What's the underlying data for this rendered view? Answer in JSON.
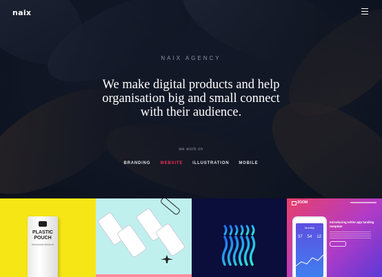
{
  "header": {
    "logo": "naix",
    "menu_icon": "hamburger-menu-icon"
  },
  "hero": {
    "kicker": "NAIX AGENCY",
    "headline_lines": [
      "We make digital products and help",
      "organisation big and small connect",
      "with their audience."
    ],
    "work_on_label": "we work on",
    "categories": [
      {
        "label": "BRANDING",
        "active": false
      },
      {
        "label": "WEBSITE",
        "active": true
      },
      {
        "label": "ILLUSTRATION",
        "active": false
      },
      {
        "label": "MOBILE",
        "active": false
      }
    ],
    "accent_color": "#ee2e5a"
  },
  "portfolio": {
    "tile1": {
      "bg": "#f6e615",
      "pouch_title": "PLASTIC POUCH",
      "pouch_sub": "PACKAGING MOCKUP"
    },
    "tile2": {
      "bg": "#bff0ee"
    },
    "tile3": {
      "bg": "#0b0d3a"
    },
    "tile4": {
      "brand": "ZOOM",
      "heading": "Introducing Ishite app landing template",
      "phone_title": "Monthly",
      "phone_stats": [
        "37",
        "54",
        "12"
      ]
    }
  }
}
